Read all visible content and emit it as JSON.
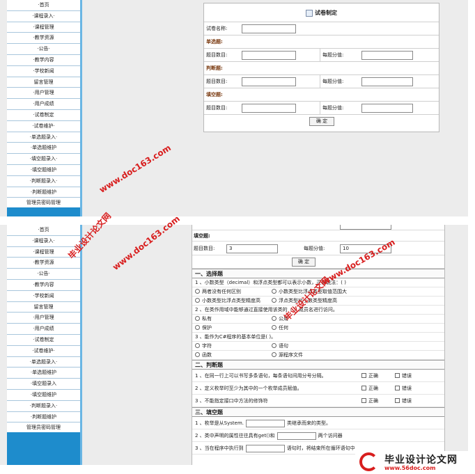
{
  "sidebar_top": [
    "·首页",
    "·课程录入·",
    "·课程管理",
    "·教学资源",
    "·公告·",
    "·教学内容",
    "·学校新闻",
    "留言管理",
    "·用户管理",
    "·用户成绩",
    "·试卷制定",
    "·试卷维护·",
    "·单选题录入·",
    "·单选题维护",
    "·填空题录入·",
    "·填空题维护",
    "·判断题录入·",
    "·判断题维护",
    "管理员密码管理"
  ],
  "sidebar_bottom": [
    "·首页",
    "·课程录入·",
    "·课程管理",
    "·教学资源",
    "·公告·",
    "·教学内容",
    "·学校新闻",
    "留言管理",
    "·用户管理",
    "·用户成绩",
    "·试卷制定",
    "·试卷维护·",
    "·单选题录入·",
    "·单选题维护",
    "·填空题录入",
    "·填空题维护",
    "·判断题录入·",
    "·判断题维护",
    "管理员密码管理"
  ],
  "form": {
    "title": "试卷制定",
    "paper_name_label": "试卷名称:",
    "single_section": "单选题:",
    "judge_section": "判断题:",
    "fill_section": "填空题:",
    "count_label": "题目数目:",
    "score_label": "每题分值:",
    "confirm": "确  定"
  },
  "bottom": {
    "fill_section": "填空题:",
    "count_label": "题目数目:",
    "count_value": "3",
    "score_label": "每题分值:",
    "score_value": "10",
    "confirm": "确  定",
    "sec1": "一、选择题",
    "q1": "1 、小数类型（decimal）和浮点类型都可以表示小数，正确说法：( )",
    "q1_opts": [
      "两者没有任何区别",
      "小数类型比浮点类型取值范围大",
      "小数类型比浮点类型精度高",
      "浮点类型比小数类型精度高"
    ],
    "q2": "2 、在类作用域中能够通过直接使用该类的（ ）成员名进行访问。",
    "q2_opts": [
      "私有",
      "公用",
      "保护",
      "任何"
    ],
    "q3": "3 、能作为C#程序的基本单位是( )。",
    "q3_opts": [
      "字符",
      "语句",
      "函数",
      "源程序文件"
    ],
    "sec2": "二、判断题",
    "j1": "1 、在同一行上可以书写多条语句，每条语句间用分号分隔。",
    "j2": "2 、定义枚举时至少为其中的一个枚举成员赋值。",
    "j3": "3 、不能指定接口中方法的修饰符",
    "true_label": "正确",
    "false_label": "错误",
    "sec3": "三、填空题",
    "f1a": "1 、枚举是从System.",
    "f1b": "类继承而来的类型。",
    "f2a": "2 、类中声明的属性往往具有get()和",
    "f2b": "两个访问器",
    "f3a": "3 、当在程序中执行到",
    "f3b": "语句时，将结束所在循环语句中"
  },
  "watermark": {
    "cn": "毕业设计论文网",
    "url": "www.doc163.com",
    "logo_title": "毕业设计论文网",
    "logo_url": "www.56doc.com"
  },
  "colors": {
    "sidebar": "#1e8ccc",
    "watermark": "#d81e1e",
    "section_text": "#7a3a10"
  }
}
